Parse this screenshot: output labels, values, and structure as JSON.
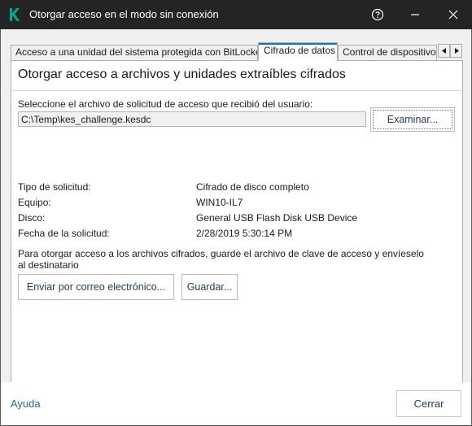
{
  "window": {
    "title": "Otorgar acceso en el modo sin conexión",
    "icons": {
      "app": "kaspersky-k-icon",
      "help": "help-icon",
      "minimize": "minimize-icon",
      "close": "close-icon"
    },
    "colors": {
      "titlebar": "#242424",
      "accent": "#00a88e",
      "tab_indicator": "#0078d7"
    }
  },
  "tabs": [
    {
      "label": "Acceso a una unidad del sistema protegida con BitLocker",
      "selected": false
    },
    {
      "label": "Cifrado de datos",
      "selected": true
    },
    {
      "label": "Control de dispositivos",
      "selected": false
    }
  ],
  "panel": {
    "heading": "Otorgar acceso a archivos y unidades extraíbles cifrados",
    "select_label": "Seleccione el archivo de solicitud de acceso que recibió del usuario:",
    "file_path": "C:\\Temp\\kes_challenge.kesdc",
    "browse_label": "Examinar...",
    "info": [
      {
        "label": "Tipo de solicitud:",
        "value": "Cifrado de disco completo"
      },
      {
        "label": "Equipo:",
        "value": "WIN10-IL7"
      },
      {
        "label": "Disco:",
        "value": "General USB Flash Disk USB Device"
      },
      {
        "label": "Fecha de la solicitud:",
        "value": "2/28/2019 5:30:14 PM"
      }
    ],
    "hint": "Para otorgar acceso a los archivos cifrados, guarde el archivo de clave de acceso y envíeselo al destinatario",
    "email_label": "Enviar por correo electrónico...",
    "save_label": "Guardar..."
  },
  "footer": {
    "help_label": "Ayuda",
    "close_label": "Cerrar"
  }
}
